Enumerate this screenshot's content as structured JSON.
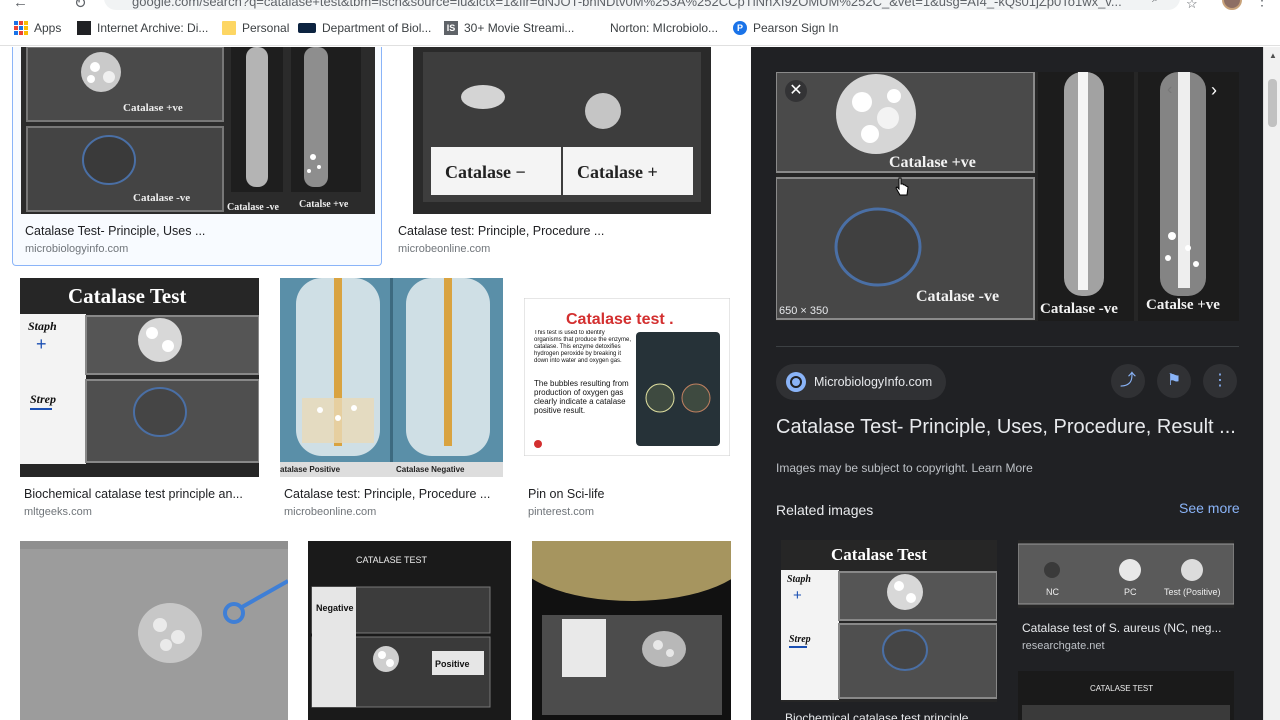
{
  "browser": {
    "url": "google.com/search?q=catalase+test&tbm=isch&source=iu&ictx=1&fir=dNJOT-bnNDtv0M%253A%252CCpTlNhXI9zOMUM%252C_&vet=1&usg=AI4_-kQs01jZp0To1wx_v..."
  },
  "bookmarks": [
    {
      "label": "Apps",
      "icon": "apps-grid-icon"
    },
    {
      "label": "Internet Archive: Di...",
      "icon": "internet-archive-icon"
    },
    {
      "label": "Personal",
      "icon": "folder-icon"
    },
    {
      "label": "Department of Biol...",
      "icon": "utsa-icon",
      "badge": "UTSA"
    },
    {
      "label": "30+ Movie Streami...",
      "icon": "is-icon",
      "badge": "IS"
    },
    {
      "label": "Norton: MIcrobiolo...",
      "icon": "none"
    },
    {
      "label": "Pearson Sign In",
      "icon": "pearson-icon",
      "badge": "P"
    }
  ],
  "results": [
    {
      "title": "Catalase Test- Principle, Uses ...",
      "source": "microbiologyinfo.com",
      "labels": [
        "Catalase +ve",
        "Catalase -ve",
        "Catalase -ve",
        "Catalse +ve"
      ]
    },
    {
      "title": "Catalase test: Principle, Procedure ...",
      "source": "microbeonline.com",
      "labels": [
        "Catalase −",
        "Catalase +"
      ]
    },
    {
      "title": "Biochemical catalase test principle an...",
      "source": "mltgeeks.com",
      "labels": [
        "Catalase Test",
        "Staph",
        "Strep"
      ]
    },
    {
      "title": "Catalase test: Principle, Procedure ...",
      "source": "microbeonline.com",
      "labels": [
        "atalase Positive",
        "Catalase Negative"
      ]
    },
    {
      "title": "Pin on Sci-life",
      "source": "pinterest.com",
      "labels": [
        "Catalase test .",
        "This test is used to identify organisms that produce the enzyme, catalase. This enzyme detoxifies hydrogen peroxide by breaking it down into water and oxygen gas.",
        "The bubbles resulting from production of oxygen gas clearly indicate a catalase positive result."
      ]
    },
    {
      "labels": []
    },
    {
      "labels": [
        "CATALASE TEST",
        "Negative",
        "Positive"
      ]
    },
    {
      "labels": []
    }
  ],
  "panel": {
    "dimensions": "650 × 350",
    "source_name": "MicrobiologyInfo.com",
    "title": "Catalase Test- Principle, Uses, Procedure, Result ...",
    "copyright": "Images may be subject to copyright.",
    "learn_more": "Learn More",
    "related_heading": "Related images",
    "see_more": "See more",
    "related": [
      {
        "title": "Biochemical catalase test principle ...",
        "labels": [
          "Catalase Test",
          "Staph",
          "Strep"
        ]
      },
      {
        "title": "Catalase test of S. aureus (NC, neg...",
        "source": "researchgate.net",
        "labels": [
          "NC",
          "PC",
          "Test (Positive)"
        ]
      },
      {
        "labels": [
          "CATALASE TEST"
        ]
      }
    ]
  },
  "colors": {
    "panel_bg": "#202124",
    "accent_link": "#8ab4f8",
    "selection_border": "#8ab4f8"
  }
}
